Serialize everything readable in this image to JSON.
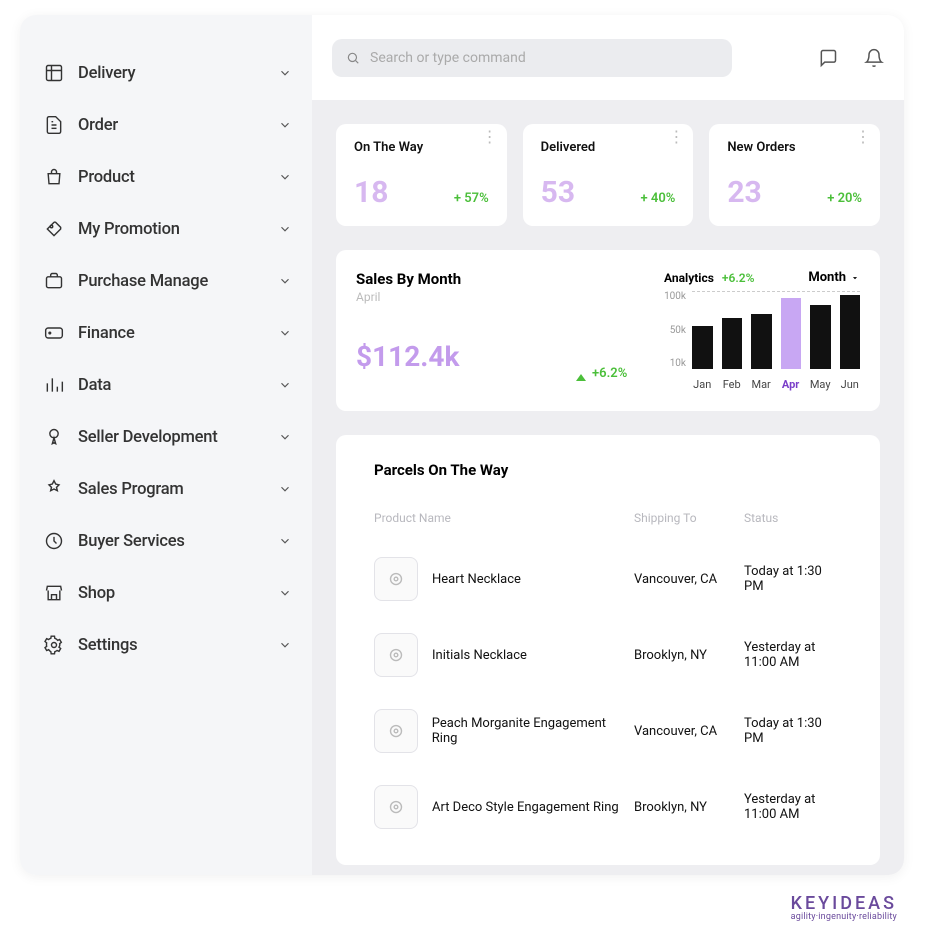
{
  "sidebar": {
    "items": [
      {
        "icon": "delivery",
        "label": "Delivery"
      },
      {
        "icon": "order",
        "label": "Order"
      },
      {
        "icon": "product",
        "label": "Product"
      },
      {
        "icon": "promotion",
        "label": "My Promotion"
      },
      {
        "icon": "purchase",
        "label": "Purchase Manage"
      },
      {
        "icon": "finance",
        "label": "Finance"
      },
      {
        "icon": "data",
        "label": "Data"
      },
      {
        "icon": "seller",
        "label": "Seller Development"
      },
      {
        "icon": "sales",
        "label": "Sales Program"
      },
      {
        "icon": "buyer",
        "label": "Buyer Services"
      },
      {
        "icon": "shop",
        "label": "Shop"
      },
      {
        "icon": "settings",
        "label": "Settings"
      }
    ]
  },
  "topbar": {
    "search_placeholder": "Search or type command"
  },
  "stats": [
    {
      "title": "On The Way",
      "value": "18",
      "delta": "+ 57%"
    },
    {
      "title": "Delivered",
      "value": "53",
      "delta": "+ 40%"
    },
    {
      "title": "New Orders",
      "value": "23",
      "delta": "+ 20%"
    }
  ],
  "sales": {
    "title": "Sales By Month",
    "month_label": "April",
    "amount": "$112.4k",
    "delta": "+6.2%",
    "analytics_label": "Analytics",
    "analytics_delta": "+6.2%",
    "selector_label": "Month"
  },
  "chart_data": {
    "type": "bar",
    "title": "Sales By Month",
    "ylabel": "",
    "xlabel": "",
    "y_tick_labels": [
      "100k",
      "50k",
      "10k"
    ],
    "ylim": [
      0,
      110
    ],
    "categories": [
      "Jan",
      "Feb",
      "Mar",
      "Apr",
      "May",
      "Jun"
    ],
    "values": [
      60,
      72,
      78,
      100,
      90,
      105
    ],
    "highlight_index": 3
  },
  "parcels": {
    "title": "Parcels On The Way",
    "headers": {
      "product": "Product Name",
      "shipping": "Shipping To",
      "status": "Status"
    },
    "rows": [
      {
        "product": "Heart Necklace",
        "shipping": "Vancouver, CA",
        "status": "Today at 1:30 PM"
      },
      {
        "product": "Initials Necklace",
        "shipping": "Brooklyn, NY",
        "status": "Yesterday at 11:00 AM"
      },
      {
        "product": "Peach Morganite Engagement Ring",
        "shipping": "Vancouver, CA",
        "status": "Today at 1:30 PM"
      },
      {
        "product": "Art Deco Style Engagement Ring",
        "shipping": "Brooklyn, NY",
        "status": "Yesterday at 11:00 AM"
      }
    ]
  },
  "brand": {
    "name": "KEYIDEAS",
    "tagline": "agility·ingenuity·reliability"
  }
}
